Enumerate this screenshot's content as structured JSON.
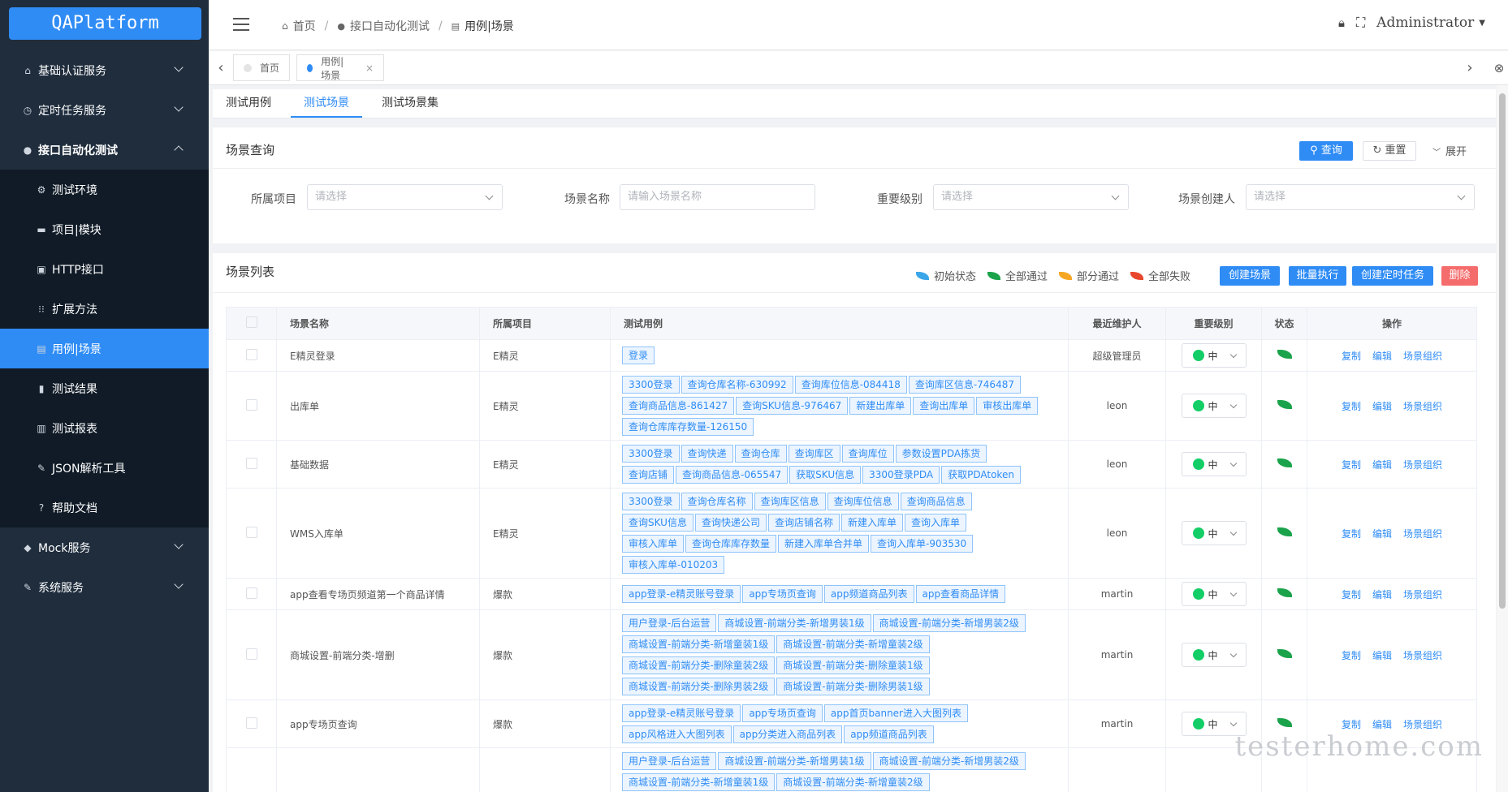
{
  "logo": "QAPlatform",
  "sidebar": {
    "items": [
      {
        "label": "基础认证服务",
        "icon": "home-icon",
        "expand": true
      },
      {
        "label": "定时任务服务",
        "icon": "clock-icon",
        "expand": true
      },
      {
        "label": "接口自动化测试",
        "icon": "bell-icon",
        "expand": true,
        "open": true
      },
      {
        "label": "测试环境",
        "icon": "gear-icon",
        "sub": true
      },
      {
        "label": "项目|模块",
        "icon": "folder-icon",
        "sub": true
      },
      {
        "label": "HTTP接口",
        "icon": "api-icon",
        "sub": true
      },
      {
        "label": "扩展方法",
        "icon": "grid-icon",
        "sub": true
      },
      {
        "label": "用例|场景",
        "icon": "table-icon",
        "sub": true,
        "active": true
      },
      {
        "label": "测试结果",
        "icon": "file-icon",
        "sub": true
      },
      {
        "label": "测试报表",
        "icon": "chart-icon",
        "sub": true
      },
      {
        "label": "JSON解析工具",
        "icon": "wrench-icon",
        "sub": true
      },
      {
        "label": "帮助文档",
        "icon": "help-icon",
        "sub": true
      },
      {
        "label": "Mock服务",
        "icon": "cube-icon",
        "expand": true
      },
      {
        "label": "系统服务",
        "icon": "wrench-icon",
        "expand": true
      }
    ]
  },
  "breadcrumb": {
    "home": "首页",
    "parent": "接口自动化测试",
    "current": "用例|场景"
  },
  "header": {
    "user": "Administrator"
  },
  "page_tabs": [
    {
      "label": "首页",
      "color": "#e4e4e4"
    },
    {
      "label": "用例|场景",
      "color": "#2f8cf5"
    }
  ],
  "sub_tabs": [
    "测试用例",
    "测试场景",
    "测试场景集"
  ],
  "query": {
    "title": "场景查询",
    "search": "查询",
    "reset": "重置",
    "expand": "展开",
    "fields": [
      {
        "label": "所属项目",
        "placeholder": "请选择"
      },
      {
        "label": "场景名称",
        "placeholder": "请输入场景名称"
      },
      {
        "label": "重要级别",
        "placeholder": "请选择"
      },
      {
        "label": "场景创建人",
        "placeholder": "请选择"
      }
    ]
  },
  "list": {
    "title": "场景列表",
    "legend": [
      {
        "label": "初始状态",
        "color": "#3aa6e8"
      },
      {
        "label": "全部通过",
        "color": "#1aa34a"
      },
      {
        "label": "部分通过",
        "color": "#f5a623"
      },
      {
        "label": "全部失败",
        "color": "#e8462d"
      }
    ],
    "buttons": [
      "创建场景",
      "批量执行",
      "创建定时任务",
      "删除"
    ],
    "columns": [
      "场景名称",
      "所属项目",
      "测试用例",
      "最近维护人",
      "重要级别",
      "状态",
      "操作"
    ],
    "ops": [
      "复制",
      "编辑",
      "场景组织"
    ],
    "rows": [
      {
        "name": "E精灵登录",
        "project": "E精灵",
        "maintainer": "超级管理员",
        "level": "中",
        "cases": [
          [
            "登录"
          ]
        ]
      },
      {
        "name": "出库单",
        "project": "E精灵",
        "maintainer": "leon",
        "level": "中",
        "cases": [
          [
            "3300登录",
            "查询仓库名称-630992",
            "查询库位信息-084418",
            "查询库区信息-746487"
          ],
          [
            "查询商品信息-861427",
            "查询SKU信息-976467",
            "新建出库单",
            "查询出库单",
            "审核出库单"
          ],
          [
            "查询仓库库存数量-126150"
          ]
        ]
      },
      {
        "name": "基础数据",
        "project": "E精灵",
        "maintainer": "leon",
        "level": "中",
        "cases": [
          [
            "3300登录",
            "查询快递",
            "查询仓库",
            "查询库区",
            "查询库位",
            "参数设置PDA拣货"
          ],
          [
            "查询店铺",
            "查询商品信息-065547",
            "获取SKU信息",
            "3300登录PDA",
            "获取PDAtoken"
          ]
        ]
      },
      {
        "name": "WMS入库单",
        "project": "E精灵",
        "maintainer": "leon",
        "level": "中",
        "cases": [
          [
            "3300登录",
            "查询仓库名称",
            "查询库区信息",
            "查询库位信息",
            "查询商品信息"
          ],
          [
            "查询SKU信息",
            "查询快递公司",
            "查询店铺名称",
            "新建入库单",
            "查询入库单"
          ],
          [
            "审核入库单",
            "查询仓库库存数量",
            "新建入库单合并单",
            "查询入库单-903530"
          ],
          [
            "审核入库单-010203"
          ]
        ]
      },
      {
        "name": "app查看专场页频道第一个商品详情",
        "project": "爆款",
        "maintainer": "martin",
        "level": "中",
        "cases": [
          [
            "app登录-e精灵账号登录",
            "app专场页查询",
            "app频道商品列表",
            "app查看商品详情"
          ]
        ]
      },
      {
        "name": "商城设置-前端分类-增删",
        "project": "爆款",
        "maintainer": "martin",
        "level": "中",
        "cases": [
          [
            "用户登录-后台运营",
            "商城设置-前端分类-新增男装1级",
            "商城设置-前端分类-新增男装2级"
          ],
          [
            "商城设置-前端分类-新增童装1级",
            "商城设置-前端分类-新增童装2级"
          ],
          [
            "商城设置-前端分类-删除童装2级",
            "商城设置-前端分类-删除童装1级"
          ],
          [
            "商城设置-前端分类-删除男装2级",
            "商城设置-前端分类-删除男装1级"
          ]
        ]
      },
      {
        "name": "app专场页查询",
        "project": "爆款",
        "maintainer": "martin",
        "level": "中",
        "cases": [
          [
            "app登录-e精灵账号登录",
            "app专场页查询",
            "app首页banner进入大图列表"
          ],
          [
            "app风格进入大图列表",
            "app分类进入商品列表",
            "app频道商品列表"
          ]
        ]
      },
      {
        "name": "",
        "project": "",
        "maintainer": "",
        "level": "",
        "cases": [
          [
            "用户登录-后台运营",
            "商城设置-前端分类-新增男装1级",
            "商城设置-前端分类-新增男装2级"
          ],
          [
            "商城设置-前端分类-新增童装1级",
            "商城设置-前端分类-新增童装2级"
          ]
        ]
      }
    ]
  },
  "watermark": "testerhome.com"
}
